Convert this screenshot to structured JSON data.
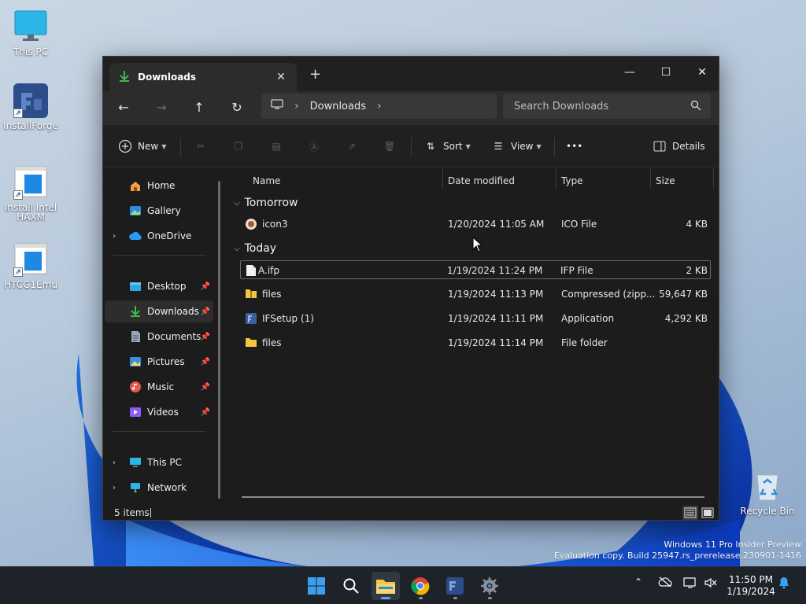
{
  "desktop": {
    "icons": [
      {
        "label": "This PC"
      },
      {
        "label": "InstallForge"
      },
      {
        "label": "Install Intel HAXM"
      },
      {
        "label": "HTCG1Emu"
      },
      {
        "label": "Recycle Bin"
      }
    ],
    "watermark": {
      "line1": "Windows 11 Pro Insider Preview",
      "line2": "Evaluation copy. Build 25947.rs_prerelease.230901-1416"
    }
  },
  "window": {
    "tab_title": "Downloads",
    "tab_close": "✕",
    "new_tab": "+",
    "controls": {
      "minimize": "—",
      "maximize": "☐",
      "close": "✕"
    },
    "address": {
      "segments": [
        "Downloads"
      ]
    },
    "search": {
      "placeholder": "Search Downloads"
    },
    "toolbar": {
      "new_label": "New",
      "sort_label": "Sort",
      "view_label": "View",
      "more_label": "•••",
      "details_label": "Details"
    },
    "sidebar": {
      "items": [
        {
          "label": "Home"
        },
        {
          "label": "Gallery"
        },
        {
          "label": "OneDrive"
        },
        {
          "label": "Desktop"
        },
        {
          "label": "Downloads"
        },
        {
          "label": "Documents"
        },
        {
          "label": "Pictures"
        },
        {
          "label": "Music"
        },
        {
          "label": "Videos"
        },
        {
          "label": "This PC"
        },
        {
          "label": "Network"
        }
      ]
    },
    "columns": [
      "Name",
      "Date modified",
      "Type",
      "Size"
    ],
    "groups": [
      {
        "label": "Tomorrow",
        "rows": [
          {
            "name": "icon3",
            "date": "1/20/2024 11:05 AM",
            "type": "ICO File",
            "size": "4 KB"
          }
        ]
      },
      {
        "label": "Today",
        "rows": [
          {
            "name": "A.ifp",
            "date": "1/19/2024 11:24 PM",
            "type": "IFP File",
            "size": "2 KB"
          },
          {
            "name": "files",
            "date": "1/19/2024 11:13 PM",
            "type": "Compressed (zipp...",
            "size": "59,647 KB"
          },
          {
            "name": "IFSetup (1)",
            "date": "1/19/2024 11:11 PM",
            "type": "Application",
            "size": "4,292 KB"
          },
          {
            "name": "files",
            "date": "1/19/2024 11:14 PM",
            "type": "File folder",
            "size": ""
          }
        ]
      }
    ],
    "status": {
      "item_count": "5 items"
    }
  },
  "taskbar": {
    "clock": {
      "time": "11:50 PM",
      "date": "1/19/2024"
    }
  },
  "colors": {
    "accent": "#4cc2ff",
    "folder": "#f4c542",
    "download_green": "#3fb950"
  }
}
